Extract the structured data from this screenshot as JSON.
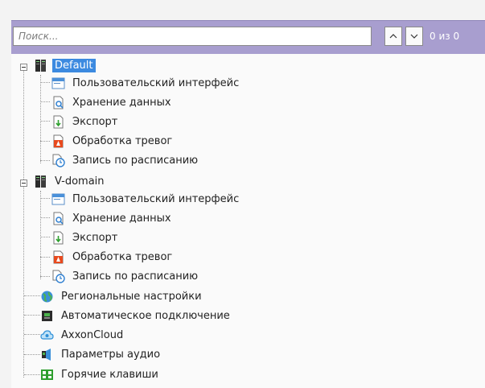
{
  "search": {
    "placeholder": "Поиск...",
    "counter": "0 из 0"
  },
  "tree": {
    "groups": [
      {
        "label": "Default",
        "children": [
          "Пользовательский интерфейс",
          "Хранение данных",
          "Экспорт",
          "Обработка тревог",
          "Запись по расписанию"
        ]
      },
      {
        "label": "V-domain",
        "children": [
          "Пользовательский интерфейс",
          "Хранение данных",
          "Экспорт",
          "Обработка тревог",
          "Запись по расписанию"
        ]
      }
    ],
    "items": [
      "Региональные настройки",
      "Автоматическое подключение",
      "AxxonCloud",
      "Параметры аудио",
      "Горячие клавиши"
    ]
  },
  "colors": {
    "header": "#a89ecf",
    "selection": "#3c8ae0"
  }
}
